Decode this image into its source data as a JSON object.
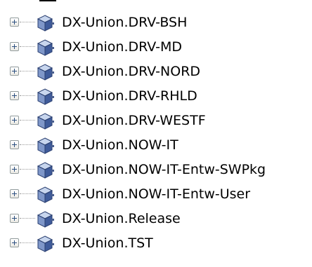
{
  "tree": {
    "nodes": [
      {
        "label": "DX-Union.DRV-BSH",
        "icon": "package-cube-icon",
        "expander": "collapsed"
      },
      {
        "label": "DX-Union.DRV-MD",
        "icon": "package-cube-icon",
        "expander": "collapsed"
      },
      {
        "label": "DX-Union.DRV-NORD",
        "icon": "package-cube-icon",
        "expander": "collapsed"
      },
      {
        "label": "DX-Union.DRV-RHLD",
        "icon": "package-cube-icon",
        "expander": "collapsed"
      },
      {
        "label": "DX-Union.DRV-WESTF",
        "icon": "package-cube-icon",
        "expander": "collapsed"
      },
      {
        "label": "DX-Union.NOW-IT",
        "icon": "package-cube-icon",
        "expander": "collapsed"
      },
      {
        "label": "DX-Union.NOW-IT-Entw-SWPkg",
        "icon": "package-cube-icon",
        "expander": "collapsed"
      },
      {
        "label": "DX-Union.NOW-IT-Entw-User",
        "icon": "package-cube-icon",
        "expander": "collapsed"
      },
      {
        "label": "DX-Union.Release",
        "icon": "package-cube-icon",
        "expander": "collapsed"
      },
      {
        "label": "DX-Union.TST",
        "icon": "package-cube-icon",
        "expander": "collapsed"
      }
    ]
  },
  "colors": {
    "cube_top": "#c8d6ee",
    "cube_left": "#7f97c9",
    "cube_right": "#3f5b9a",
    "cube_edge": "#2a3f70",
    "pipe": "#4a5f8f",
    "expander_border": "#919b9c",
    "connector": "#9a9a9a"
  }
}
